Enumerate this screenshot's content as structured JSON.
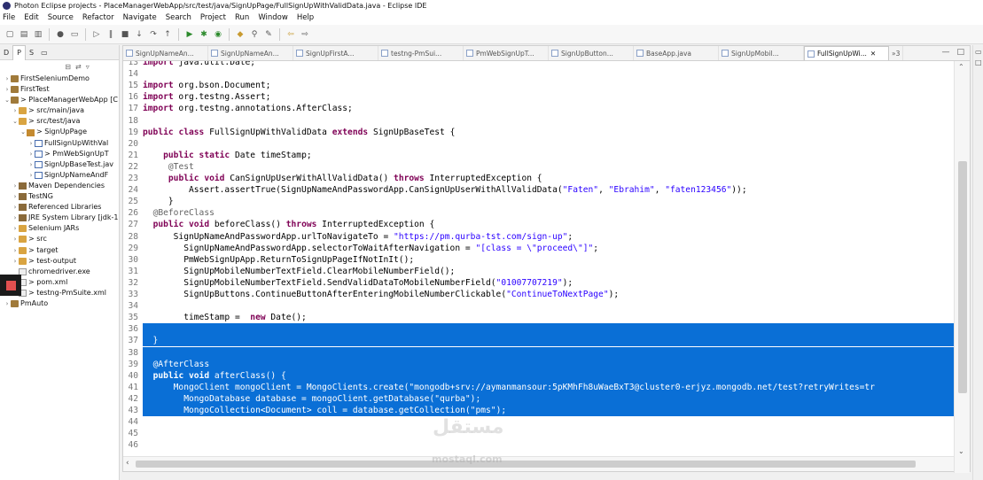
{
  "window": {
    "title": "Photon Eclipse projects - PlaceManagerWebApp/src/test/java/SignUpPage/FullSignUpWithValidData.java - Eclipse IDE"
  },
  "menu": [
    "File",
    "Edit",
    "Source",
    "Refactor",
    "Navigate",
    "Search",
    "Project",
    "Run",
    "Window",
    "Help"
  ],
  "left_panel": {
    "tabs": [
      "D",
      "P",
      "S"
    ],
    "tree": [
      {
        "label": "FirstSeleniumDemo",
        "indent": 0,
        "expanded": false,
        "icon": "project"
      },
      {
        "label": "FirstTest",
        "indent": 0,
        "expanded": false,
        "icon": "project"
      },
      {
        "label": "> PlaceManagerWebApp [C",
        "indent": 0,
        "expanded": true,
        "icon": "project"
      },
      {
        "label": "> src/main/java",
        "indent": 1,
        "expanded": false,
        "icon": "folder"
      },
      {
        "label": "> src/test/java",
        "indent": 1,
        "expanded": true,
        "icon": "folder"
      },
      {
        "label": "> SignUpPage",
        "indent": 2,
        "expanded": true,
        "icon": "package"
      },
      {
        "label": "FullSignUpWithVal",
        "indent": 3,
        "expanded": false,
        "icon": "java"
      },
      {
        "label": "> PmWebSignUpT",
        "indent": 3,
        "expanded": false,
        "icon": "java"
      },
      {
        "label": "SignUpBaseTest.jav",
        "indent": 3,
        "expanded": false,
        "icon": "java"
      },
      {
        "label": "SignUpNameAndF",
        "indent": 3,
        "expanded": false,
        "icon": "java"
      },
      {
        "label": "Maven Dependencies",
        "indent": 1,
        "expanded": false,
        "icon": "library"
      },
      {
        "label": "TestNG",
        "indent": 1,
        "expanded": false,
        "icon": "library"
      },
      {
        "label": "Referenced Libraries",
        "indent": 1,
        "expanded": false,
        "icon": "library"
      },
      {
        "label": "JRE System Library [jdk-1",
        "indent": 1,
        "expanded": false,
        "icon": "library"
      },
      {
        "label": "Selenium JARs",
        "indent": 1,
        "expanded": false,
        "icon": "folder"
      },
      {
        "label": "> src",
        "indent": 1,
        "expanded": false,
        "icon": "folder"
      },
      {
        "label": "> target",
        "indent": 1,
        "expanded": false,
        "icon": "folder"
      },
      {
        "label": "> test-output",
        "indent": 1,
        "expanded": false,
        "icon": "folder"
      },
      {
        "label": "chromedriver.exe",
        "indent": 1,
        "expanded": null,
        "icon": "file"
      },
      {
        "label": "> pom.xml",
        "indent": 1,
        "expanded": null,
        "icon": "file"
      },
      {
        "label": "> testng-PmSuite.xml",
        "indent": 1,
        "expanded": null,
        "icon": "file"
      },
      {
        "label": "PmAuto",
        "indent": 0,
        "expanded": false,
        "icon": "project"
      }
    ]
  },
  "editor": {
    "tabs": [
      {
        "label": "SignUpNameAn...",
        "active": false
      },
      {
        "label": "SignUpNameAn...",
        "active": false
      },
      {
        "label": "SignUpFirstA...",
        "active": false
      },
      {
        "label": "testng-PmSui...",
        "active": false
      },
      {
        "label": "PmWebSignUpT...",
        "active": false
      },
      {
        "label": "SignUpButton...",
        "active": false
      },
      {
        "label": "BaseApp.java",
        "active": false
      },
      {
        "label": "SignUpMobil...",
        "active": false
      },
      {
        "label": "FullSignUpWi...",
        "active": true
      }
    ],
    "overflow_count": "»3",
    "lines": [
      {
        "n": "13",
        "text": "import java.util.Date;",
        "sel": false
      },
      {
        "n": "14",
        "text": "",
        "sel": false
      },
      {
        "n": "15",
        "text": "import org.bson.Document;",
        "sel": false
      },
      {
        "n": "16",
        "text": "import org.testng.Assert;",
        "sel": false
      },
      {
        "n": "17",
        "text": "import org.testng.annotations.AfterClass;",
        "sel": false
      },
      {
        "n": "18",
        "text": "",
        "sel": false
      },
      {
        "n": "19",
        "text": "public class FullSignUpWithValidData extends SignUpBaseTest {",
        "sel": false
      },
      {
        "n": "20",
        "text": "",
        "sel": false
      },
      {
        "n": "21",
        "text": "    public static Date timeStamp;",
        "sel": false
      },
      {
        "n": "22",
        "text": "     @Test",
        "sel": false
      },
      {
        "n": "23",
        "text": "     public void CanSignUpUserWithAllValidData() throws InterruptedException {",
        "sel": false
      },
      {
        "n": "24",
        "text": "         Assert.assertTrue(SignUpNameAndPasswordApp.CanSignUpUserWithAllValidData(\"Faten\", \"Ebrahim\", \"faten123456\"));",
        "sel": false
      },
      {
        "n": "25",
        "text": "     }",
        "sel": false
      },
      {
        "n": "26",
        "text": "  @BeforeClass",
        "sel": false
      },
      {
        "n": "27",
        "text": "  public void beforeClass() throws InterruptedException {",
        "sel": false
      },
      {
        "n": "28",
        "text": "      SignUpNameAndPasswordApp.urlToNavigateTo = \"https://pm.qurba-tst.com/sign-up\";",
        "sel": false
      },
      {
        "n": "29",
        "text": "        SignUpNameAndPasswordApp.selectorToWaitAfterNavigation = \"[class = \\\"proceed\\\"]\";",
        "sel": false
      },
      {
        "n": "30",
        "text": "        PmWebSignUpApp.ReturnToSignUpPageIfNotInIt();",
        "sel": false
      },
      {
        "n": "31",
        "text": "        SignUpMobileNumberTextField.ClearMobileNumberField();",
        "sel": false
      },
      {
        "n": "32",
        "text": "        SignUpMobileNumberTextField.SendValidDataToMobileNumberField(\"01007707219\");",
        "sel": false
      },
      {
        "n": "33",
        "text": "        SignUpButtons.ContinueButtonAfterEnteringMobileNumberClickable(\"ContinueToNextPage\");",
        "sel": false
      },
      {
        "n": "34",
        "text": "",
        "sel": false
      },
      {
        "n": "35",
        "text": "        timeStamp =  new Date();",
        "sel": false
      },
      {
        "n": "36",
        "text": "",
        "sel": true
      },
      {
        "n": "37",
        "text": "  }",
        "sel": true
      },
      {
        "n": "38",
        "text": "",
        "sel": true
      },
      {
        "n": "39",
        "text": "  @AfterClass",
        "sel": true
      },
      {
        "n": "40",
        "text": "  public void afterClass() {",
        "sel": true
      },
      {
        "n": "41",
        "text": "      MongoClient mongoClient = MongoClients.create(\"mongodb+srv://aymanmansour:5pKMhFh8uWaeBxT3@cluster0-erjyz.mongodb.net/test?retryWrites=tr",
        "sel": true
      },
      {
        "n": "42",
        "text": "        MongoDatabase database = mongoClient.getDatabase(\"qurba\");",
        "sel": true
      },
      {
        "n": "43",
        "text": "        MongoCollection<Document> coll = database.getCollection(\"pms\");",
        "sel": true
      },
      {
        "n": "44",
        "text": "",
        "sel": false
      },
      {
        "n": "45",
        "text": "",
        "sel": false
      },
      {
        "n": "46",
        "text": "",
        "sel": false
      }
    ]
  },
  "watermark": {
    "brand": "mostaql.com",
    "arabic": "مستقل"
  },
  "colors": {
    "selection": "#0a6fd6",
    "keyword": "#7f0055",
    "string": "#2a00ff"
  }
}
